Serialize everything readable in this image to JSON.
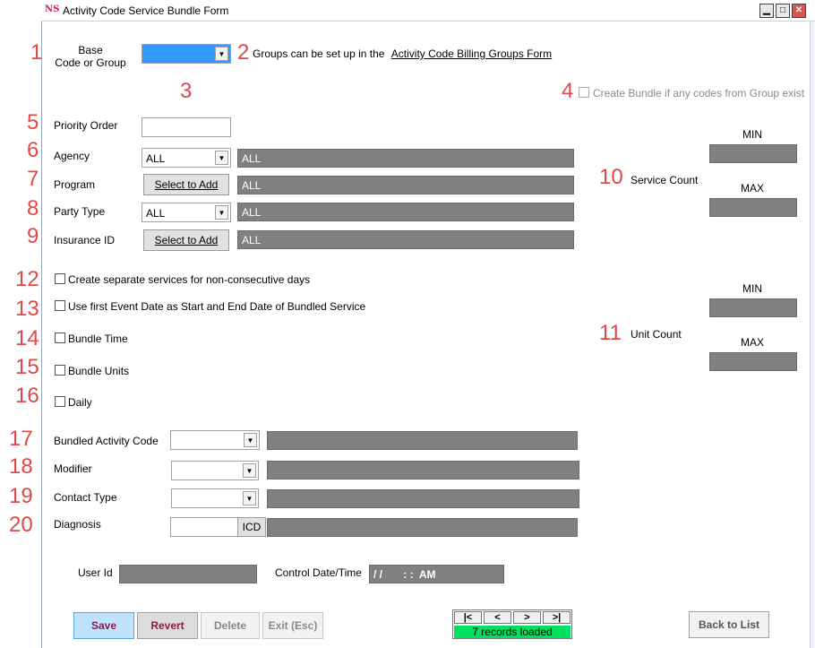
{
  "window": {
    "logo_text": "NS",
    "title": "Activity Code Service Bundle Form",
    "minimize": "▁",
    "maximize": "□",
    "close": "✕"
  },
  "annotations": [
    "1",
    "2",
    "3",
    "4",
    "5",
    "6",
    "7",
    "8",
    "9",
    "10",
    "11",
    "12",
    "13",
    "14",
    "15",
    "16",
    "17",
    "18",
    "19",
    "20"
  ],
  "base": {
    "label_line1": "Base",
    "label_line2": "Code or Group",
    "selected_value": ""
  },
  "groups_note": {
    "text": "Groups can be set up in the",
    "link": "Activity Code Billing Groups Form"
  },
  "create_bundle": {
    "label": "Create Bundle if any codes from Group exist",
    "checked": false
  },
  "priority": {
    "label": "Priority Order",
    "value": ""
  },
  "agency": {
    "label": "Agency",
    "selected": "ALL",
    "description": "ALL"
  },
  "program": {
    "label": "Program",
    "button": "Select to Add",
    "description": "ALL"
  },
  "party_type": {
    "label": "Party Type",
    "selected": "ALL",
    "description": "ALL"
  },
  "insurance": {
    "label": "Insurance ID",
    "button": "Select to Add",
    "description": "ALL"
  },
  "service_count": {
    "label": "Service Count",
    "min_label": "MIN",
    "max_label": "MAX",
    "min": "",
    "max": ""
  },
  "unit_count": {
    "label": "Unit Count",
    "min_label": "MIN",
    "max_label": "MAX",
    "min": "",
    "max": ""
  },
  "checkboxes": {
    "separate_services": "Create separate services for non-consecutive days",
    "first_event_date": "Use first Event Date as Start and End Date of Bundled Service",
    "bundle_time": "Bundle Time",
    "bundle_units": "Bundle Units",
    "daily": "Daily"
  },
  "bundled_activity": {
    "label": "Bundled Activity Code",
    "selected": "",
    "description": ""
  },
  "modifier": {
    "label": "Modifier",
    "selected": "",
    "description": ""
  },
  "contact_type": {
    "label": "Contact Type",
    "selected": "",
    "description": ""
  },
  "diagnosis": {
    "label": "Diagnosis",
    "value": "",
    "icd_button": "ICD",
    "description": ""
  },
  "footer": {
    "user_id_label": "User Id",
    "user_id_value": "",
    "control_label": "Control Date/Time",
    "control_value": "/ /       : :  AM"
  },
  "buttons": {
    "save": "Save",
    "revert": "Revert",
    "delete": "Delete",
    "exit": "Exit (Esc)",
    "back": "Back to List"
  },
  "nav": {
    "first": "|<",
    "prev": "<",
    "next": ">",
    "last": ">|",
    "status": "7 records loaded"
  },
  "colors": {
    "gray_field": "#808080",
    "annotation_red": "#e04848",
    "status_green": "#00e060",
    "base_select_blue": "#3399ff"
  }
}
